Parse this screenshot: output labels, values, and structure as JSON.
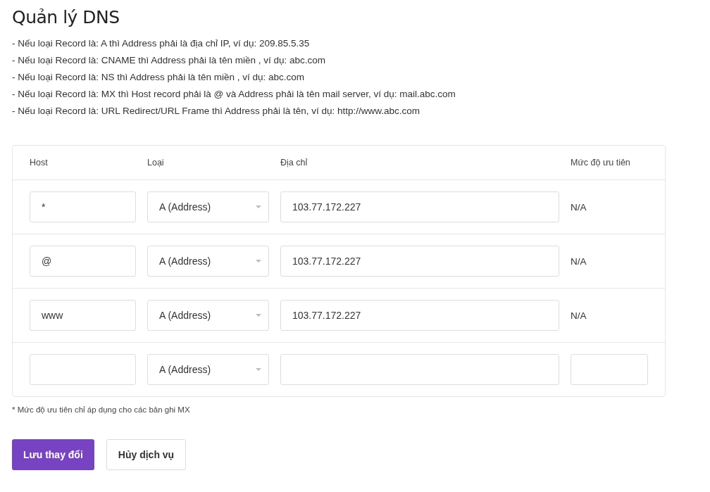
{
  "title": "Quản lý DNS",
  "notes": [
    "- Nếu loại Record là: A thì Address phải là địa chỉ IP, ví dụ: 209.85.5.35",
    "- Nếu loại Record là: CNAME thì Address phải là tên miền , ví dụ: abc.com",
    "- Nếu loại Record là: NS thì Address phải là tên miền , ví dụ: abc.com",
    "- Nếu loại Record là: MX thì Host record phải là @ và Address phải là tên mail server, ví dụ: mail.abc.com",
    "- Nếu loại Record là: URL Redirect/URL Frame thì Address phải là tên, ví dụ: http://www.abc.com"
  ],
  "table": {
    "columns": [
      "Host",
      "Loại",
      "Địa chỉ",
      "Mức độ ưu tiên"
    ],
    "rows": [
      {
        "kind": "record",
        "host": "*",
        "type": "A (Address)",
        "address": "103.77.172.227",
        "priority": "N/A"
      },
      {
        "kind": "record",
        "host": "@",
        "type": "A (Address)",
        "address": "103.77.172.227",
        "priority": "N/A"
      },
      {
        "kind": "record",
        "host": "www",
        "type": "A (Address)",
        "address": "103.77.172.227",
        "priority": "N/A"
      },
      {
        "kind": "new",
        "type": "A (Address)"
      }
    ]
  },
  "footnote": "* Mức độ ưu tiên chỉ áp dụng cho các bản ghi MX",
  "buttons": [
    {
      "kind": "primary",
      "label": "Lưu thay đổi"
    },
    {
      "kind": "secondary",
      "label": "Hủy dịch vụ"
    }
  ]
}
